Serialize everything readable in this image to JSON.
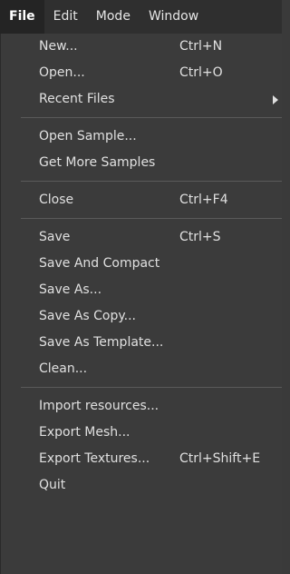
{
  "menubar": {
    "items": [
      {
        "label": "File"
      },
      {
        "label": "Edit"
      },
      {
        "label": "Mode"
      },
      {
        "label": "Window"
      }
    ]
  },
  "file_menu": {
    "groups": [
      [
        {
          "label": "New...",
          "shortcut": "Ctrl+N"
        },
        {
          "label": "Open...",
          "shortcut": "Ctrl+O"
        },
        {
          "label": "Recent Files",
          "submenu": true
        }
      ],
      [
        {
          "label": "Open Sample..."
        },
        {
          "label": "Get More Samples"
        }
      ],
      [
        {
          "label": "Close",
          "shortcut": "Ctrl+F4"
        }
      ],
      [
        {
          "label": "Save",
          "shortcut": "Ctrl+S"
        },
        {
          "label": "Save And Compact"
        },
        {
          "label": "Save As..."
        },
        {
          "label": "Save As Copy..."
        },
        {
          "label": "Save As Template..."
        },
        {
          "label": "Clean..."
        }
      ],
      [
        {
          "label": "Import resources..."
        },
        {
          "label": "Export Mesh..."
        },
        {
          "label": "Export Textures...",
          "shortcut": "Ctrl+Shift+E"
        },
        {
          "label": "Quit"
        }
      ]
    ]
  }
}
